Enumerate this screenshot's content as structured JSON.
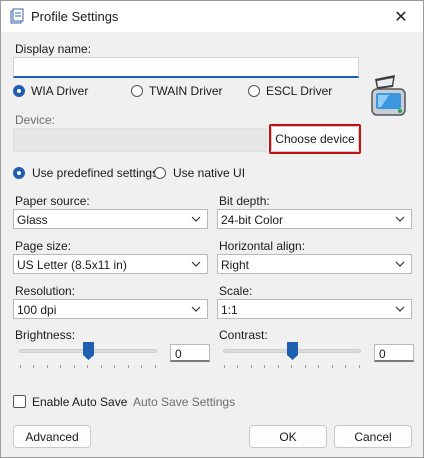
{
  "window": {
    "title": "Profile Settings",
    "close_glyph": "✕"
  },
  "display_name": {
    "label": "Display name:",
    "value": ""
  },
  "drivers": [
    {
      "label": "WIA Driver",
      "selected": true
    },
    {
      "label": "TWAIN Driver",
      "selected": false
    },
    {
      "label": "ESCL Driver",
      "selected": false
    }
  ],
  "device": {
    "label": "Device:",
    "value": "",
    "choose_label": "Choose device",
    "icon": "scanner-icon"
  },
  "settings_mode": [
    {
      "label": "Use predefined settings",
      "selected": true
    },
    {
      "label": "Use native UI",
      "selected": false
    }
  ],
  "fields": {
    "paper_source": {
      "label": "Paper source:",
      "value": "Glass"
    },
    "bit_depth": {
      "label": "Bit depth:",
      "value": "24-bit Color"
    },
    "page_size": {
      "label": "Page size:",
      "value": "US Letter (8.5x11 in)"
    },
    "horizontal_align": {
      "label": "Horizontal align:",
      "value": "Right"
    },
    "resolution": {
      "label": "Resolution:",
      "value": "100 dpi"
    },
    "scale": {
      "label": "Scale:",
      "value": "1:1"
    }
  },
  "brightness": {
    "label": "Brightness:",
    "value": "0",
    "level": 0.5
  },
  "contrast": {
    "label": "Contrast:",
    "value": "0",
    "level": 0.5
  },
  "auto_save": {
    "label": "Enable Auto Save",
    "checked": false,
    "settings_label": "Auto Save Settings"
  },
  "buttons": {
    "advanced": "Advanced",
    "ok": "OK",
    "cancel": "Cancel"
  },
  "colors": {
    "accent": "#1f5fb0",
    "highlight_border": "#c40f0f"
  }
}
